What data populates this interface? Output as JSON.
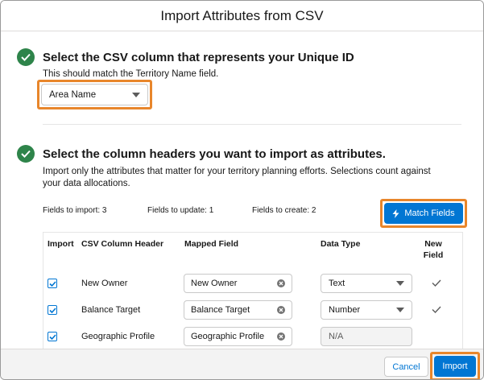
{
  "modal": {
    "title": "Import Attributes from CSV"
  },
  "section1": {
    "title": "Select the CSV column that represents your Unique ID",
    "help": "This should match the Territory Name field.",
    "select_value": "Area Name"
  },
  "section2": {
    "title": "Select the column headers you want to import as attributes.",
    "help": "Import only the attributes that matter for your territory planning efforts. Selections count against your data allocations."
  },
  "stats": {
    "import": "Fields to import: 3",
    "update": "Fields to update: 1",
    "create": "Fields to create: 2"
  },
  "match_button": "Match Fields",
  "table": {
    "headers": {
      "import": "Import",
      "csv": "CSV Column Header",
      "mapped": "Mapped Field",
      "type": "Data Type",
      "new_field": "New Field"
    },
    "rows": [
      {
        "csv": "New Owner",
        "mapped": "New Owner",
        "type": "Text",
        "type_disabled": false,
        "new_field": true,
        "checked": true
      },
      {
        "csv": "Balance Target",
        "mapped": "Balance Target",
        "type": "Number",
        "type_disabled": false,
        "new_field": true,
        "checked": true
      },
      {
        "csv": "Geographic Profile",
        "mapped": "Geographic Profile",
        "type": "N/A",
        "type_disabled": true,
        "new_field": false,
        "checked": true
      }
    ]
  },
  "footer": {
    "cancel": "Cancel",
    "import": "Import"
  },
  "colors": {
    "brand": "#0176d3",
    "success": "#2e844a",
    "highlight": "#e8862b"
  }
}
